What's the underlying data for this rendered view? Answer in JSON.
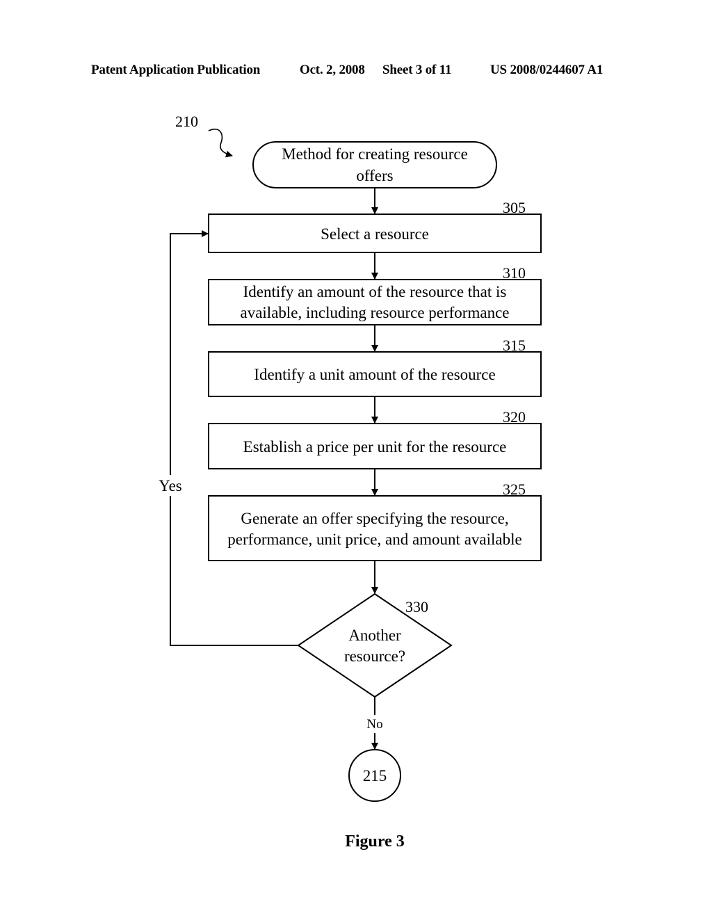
{
  "header": {
    "publication": "Patent Application Publication",
    "date": "Oct. 2, 2008",
    "sheet": "Sheet 3 of 11",
    "number": "US 2008/0244607 A1"
  },
  "diagram": {
    "method_ref": "210",
    "start": {
      "line1": "Method for creating resource",
      "line2": "offers"
    },
    "steps": [
      {
        "ref": "305",
        "line1": "Select a resource",
        "line2": ""
      },
      {
        "ref": "310",
        "line1": "Identify an amount of the resource that is",
        "line2": "available, including resource performance"
      },
      {
        "ref": "315",
        "line1": "Identify a unit amount of the resource",
        "line2": ""
      },
      {
        "ref": "320",
        "line1": "Establish a price per unit for the resource",
        "line2": ""
      },
      {
        "ref": "325",
        "line1": "Generate an offer specifying the resource,",
        "line2": "performance, unit price, and amount available"
      }
    ],
    "decision": {
      "ref": "330",
      "line1": "Another",
      "line2": "resource?",
      "yes_label": "Yes",
      "no_label": "No"
    },
    "end_connector": "215",
    "figure_caption": "Figure 3"
  }
}
